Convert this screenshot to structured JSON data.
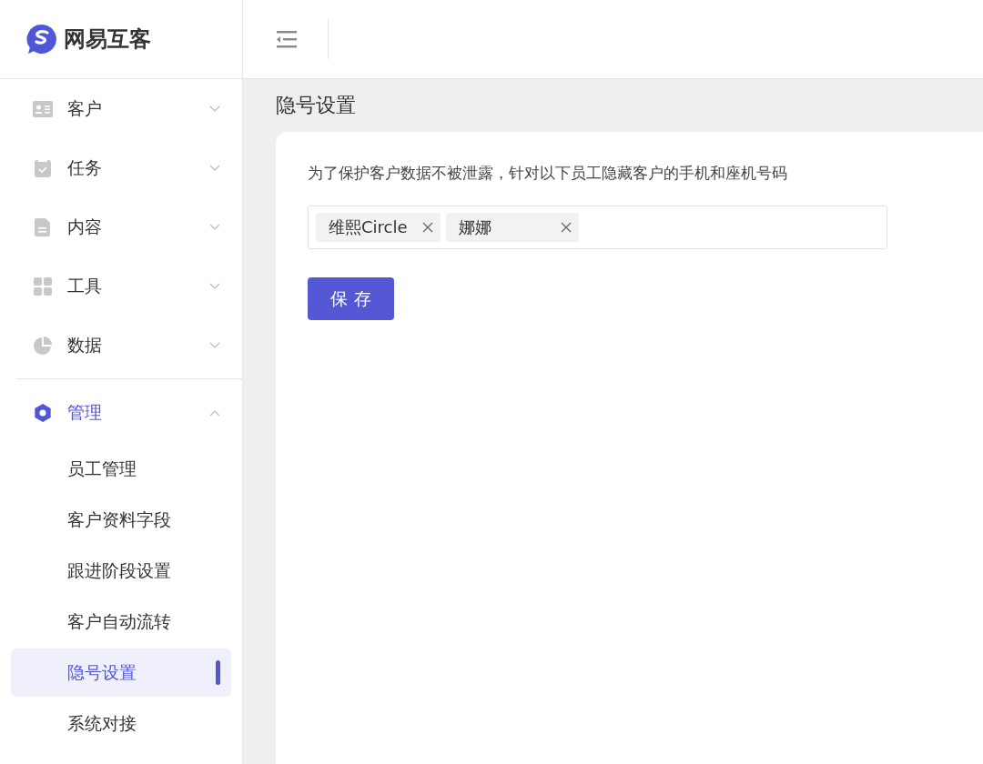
{
  "brand": {
    "name": "网易互客"
  },
  "sidebar": {
    "items": [
      {
        "label": "客户",
        "expanded": false,
        "selected": false
      },
      {
        "label": "任务",
        "expanded": false,
        "selected": false
      },
      {
        "label": "内容",
        "expanded": false,
        "selected": false
      },
      {
        "label": "工具",
        "expanded": false,
        "selected": false
      },
      {
        "label": "数据",
        "expanded": false,
        "selected": false
      },
      {
        "label": "管理",
        "expanded": true,
        "selected": true,
        "children": [
          {
            "label": "员工管理",
            "selected": false
          },
          {
            "label": "客户资料字段",
            "selected": false
          },
          {
            "label": "跟进阶段设置",
            "selected": false
          },
          {
            "label": "客户自动流转",
            "selected": false
          },
          {
            "label": "隐号设置",
            "selected": true
          },
          {
            "label": "系统对接",
            "selected": false
          }
        ]
      }
    ]
  },
  "page": {
    "title": "隐号设置",
    "description": "为了保护客户数据不被泄露，针对以下员工隐藏客户的手机和座机号码",
    "selected_staff": [
      "维熙Circle",
      "娜娜"
    ],
    "save_button": "保 存"
  }
}
